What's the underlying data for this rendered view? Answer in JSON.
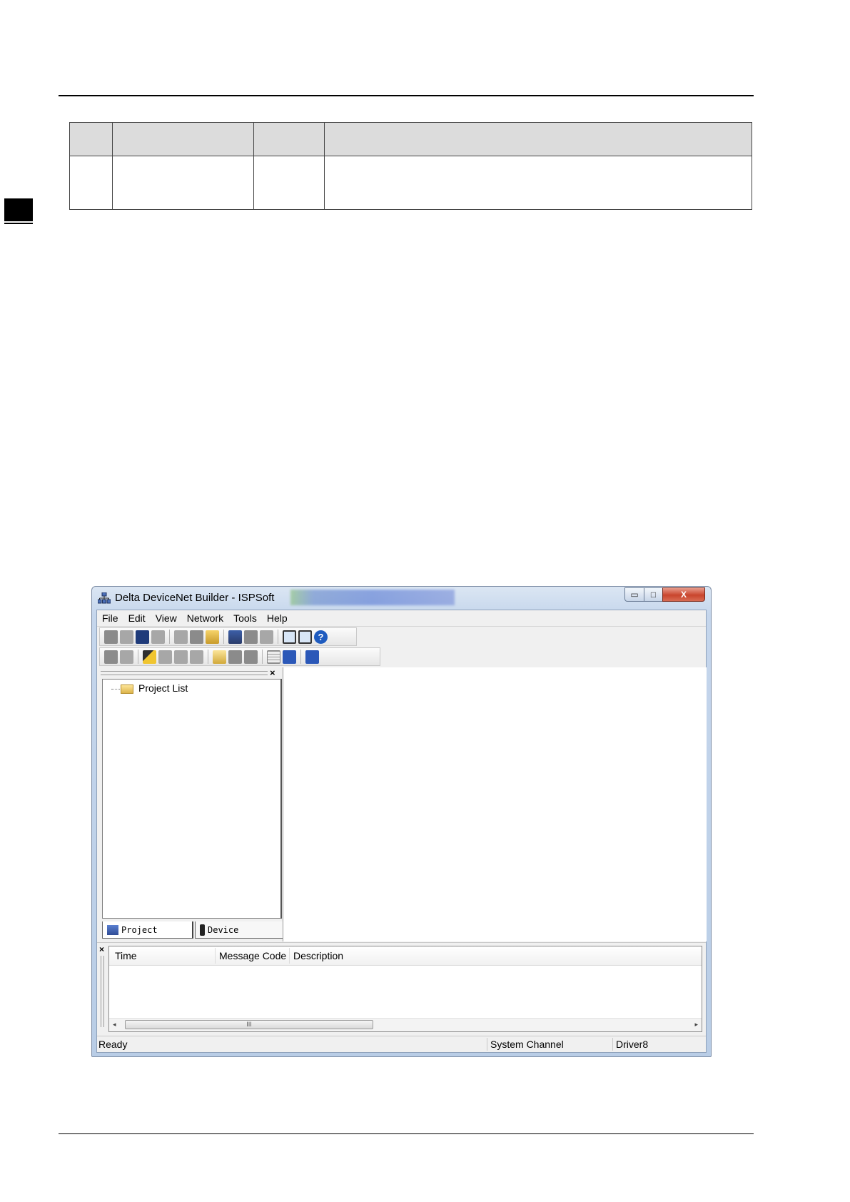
{
  "spec_table": {
    "header_cells": [
      "",
      "",
      "",
      ""
    ],
    "row_cells": [
      "",
      "",
      "",
      ""
    ]
  },
  "window": {
    "title": "Delta DeviceNet Builder - ISPSoft",
    "buttons": {
      "minimize": "▭",
      "maximize": "□",
      "close": "X"
    },
    "menu": [
      "File",
      "Edit",
      "View",
      "Network",
      "Tools",
      "Help"
    ],
    "project_tree": {
      "root_label": "Project List",
      "close_glyph": "×"
    },
    "tabs": {
      "project": "Project",
      "device": "Device"
    },
    "message_list": {
      "close_glyph": "×",
      "columns": [
        "Time",
        "Message Code",
        "Description"
      ],
      "scroll_thumb_glyph": "III",
      "scroll_left": "◂",
      "scroll_right": "▸"
    },
    "status_bar": {
      "ready": "Ready",
      "channel": "System Channel",
      "driver": "Driver8"
    },
    "icons": {
      "help": "?"
    }
  }
}
